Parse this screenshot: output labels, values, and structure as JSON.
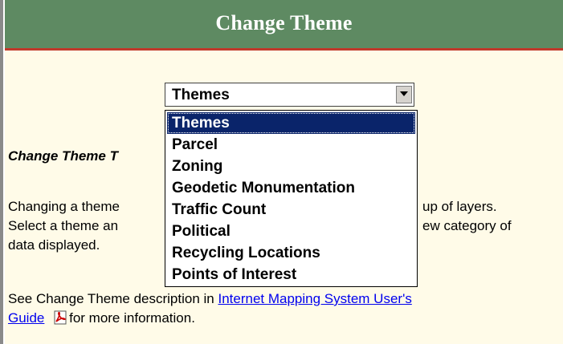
{
  "header": {
    "title": "Change Theme"
  },
  "theme_select": {
    "selected": "Themes",
    "options": [
      "Themes",
      "Parcel",
      "Zoning",
      "Geodetic Monumentation",
      "Traffic Count",
      "Political",
      "Recycling Locations",
      "Points of Interest"
    ]
  },
  "tips": {
    "heading_visible": "Change Theme T",
    "line1_left": "Changing a theme",
    "line1_right": "up of layers.",
    "line2_left": "Select a theme an",
    "line2_right": "ew category of",
    "line3": "data displayed."
  },
  "see_also": {
    "prefix": "See Change Theme description in ",
    "link_part1": "Internet Mapping System User's",
    "link_part2": "Guide",
    "suffix": " for more information.",
    "icon": "pdf-icon"
  },
  "colors": {
    "header_bg": "#5e8a62",
    "header_border": "#c0392b",
    "panel_bg": "#fffbe8",
    "selection": "#0a246a",
    "link": "#0000ee"
  }
}
